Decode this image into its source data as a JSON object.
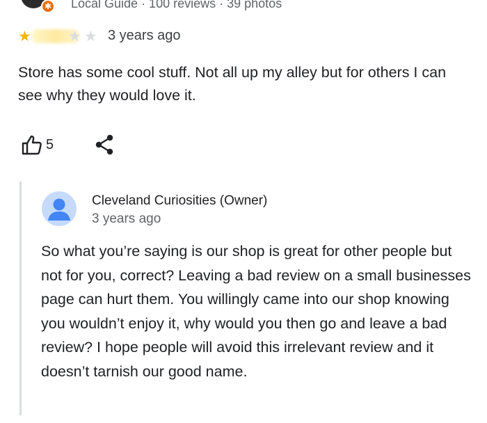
{
  "review": {
    "reviewer_meta": "Local Guide · 100 reviews · 39 photos",
    "rating": {
      "value": 1,
      "max": 5
    },
    "time_ago": "3 years ago",
    "text": "Store has some cool stuff. Not all up my alley but for others I can see why they would love it.",
    "like_count": "5",
    "icons": [
      "thumbs-up-icon",
      "share-icon",
      "local-guide-badge-icon"
    ],
    "colors": {
      "star_filled": "#f4b400",
      "star_empty": "#dadce0",
      "badge": "#e8710a"
    }
  },
  "owner_reply": {
    "name": "Cleveland Curiosities (Owner)",
    "time_ago": "3 years ago",
    "text": "So what you’re saying is our shop is great for other people but not for you, correct? Leaving a bad review on a small businesses page can hurt them. You willingly came into our shop knowing you wouldn’t enjoy it, why would you then go and leave a bad review? I hope people will avoid this irrelevant review and it doesn’t tarnish our good name.",
    "avatar_icon": "default-person-avatar-icon",
    "colors": {
      "avatar_bg": "#c6dafc",
      "avatar_fg": "#4285f4",
      "reply_bar": "#dadce0"
    }
  }
}
